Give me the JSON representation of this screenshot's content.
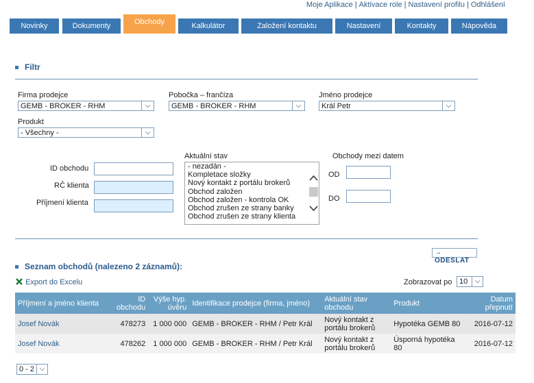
{
  "toplinks": [
    "Moje Aplikace",
    "Aktivace role",
    "Nastavení profilu",
    "Odhlášení"
  ],
  "nav": {
    "tabs": [
      {
        "label": "Novinky",
        "active": false
      },
      {
        "label": "Dokumenty",
        "active": false
      },
      {
        "label": "Obchody",
        "active": true
      },
      {
        "label": "Kalkulátor",
        "active": false
      },
      {
        "label": "Založení kontaktu",
        "active": false
      },
      {
        "label": "Nastavení",
        "active": false
      },
      {
        "label": "Kontakty",
        "active": false
      },
      {
        "label": "Nápověda",
        "active": false
      }
    ]
  },
  "filter": {
    "title": "Filtr",
    "firma_label": "Firma prodejce",
    "firma_value": "GEMB - BROKER - RHM",
    "pobocka_label": "Pobočka – frančíza",
    "pobocka_value": "GEMB - BROKER - RHM",
    "jmeno_label": "Jméno prodejce",
    "jmeno_value": "Král Petr",
    "produkt_label": "Produkt",
    "produkt_value": "- Všechny -",
    "id_label": "ID obchodu",
    "rc_label": "RČ klienta",
    "prijmeni_label": "Příjmení klienta",
    "stav_label": "Aktuální stav",
    "stav_options": [
      "- nezadán -",
      "Kompletace složky",
      "Nový kontakt z portálu brokerů",
      "Obchod založen",
      "Obchod založen - kontrola OK",
      "Obchod zrušen ze strany banky",
      "Obchod zrušen ze strany klienta"
    ],
    "datum_label": "Obchody mezi datem",
    "od_label": "OD",
    "do_label": "DO",
    "send_label": "ODESLAT"
  },
  "list": {
    "title": "Seznam obchodů (nalezeno 2 záznamů):",
    "export_label": "Export do Excelu",
    "show_label": "Zobrazovat po",
    "show_value": "10",
    "columns": {
      "name": "Příjmení a jméno klienta",
      "id": "ID obchodu",
      "amount": "Výše hyp. úvěru",
      "seller": "Identifikace prodejce (firma, jméno)",
      "state": "Aktuální stav obchodu",
      "product": "Produkt",
      "date": "Datum přepnutí"
    },
    "rows": [
      {
        "name": "Josef Novák",
        "id": "478273",
        "amount": "1 000 000",
        "seller": "GEMB - BROKER - RHM / Petr Král",
        "state": "Nový kontakt z portálu brokerů",
        "product": "Hypotéka GEMB 80",
        "date": "2016-07-12"
      },
      {
        "name": "Josef Novák",
        "id": "478262",
        "amount": "1 000 000",
        "seller": "GEMB - BROKER - RHM / Petr Král",
        "state": "Nový kontakt z portálu brokerů",
        "product": "Úsporná hypotéka 80",
        "date": "2016-07-12"
      }
    ],
    "pager_value": "0 - 2"
  }
}
